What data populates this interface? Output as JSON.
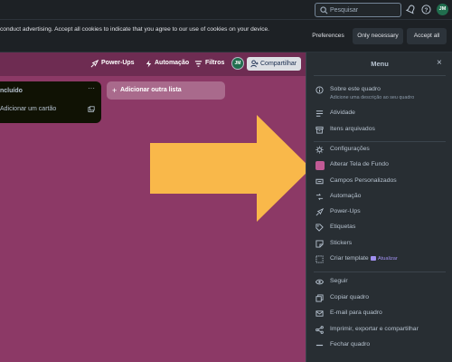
{
  "topbar": {
    "search_placeholder": "Pesquisar",
    "avatar_initials": "JM"
  },
  "cookie_banner": {
    "message": "conduct advertising. Accept all cookies to indicate that you agree to our use of cookies on your device.",
    "preferences_label": "Preferences",
    "only_necessary_label": "Only necessary",
    "accept_all_label": "Accept all"
  },
  "board_header": {
    "powerups_label": "Power-Ups",
    "automation_label": "Automação",
    "filters_label": "Filtros",
    "avatar_initials": "JM",
    "share_label": "Compartilhar"
  },
  "list": {
    "title": "ncluído",
    "more": "···",
    "add_card_label": "Adicionar um cartão"
  },
  "add_list_label": "Adicionar outra lista",
  "menu": {
    "title": "Menu",
    "close": "×",
    "groups": [
      [
        {
          "icon": "info-icon",
          "label": "Sobre este quadro",
          "sub": "Adicione uma descrição ao seu quadro"
        },
        {
          "icon": "activity-icon",
          "label": "Atividade"
        },
        {
          "icon": "archive-icon",
          "label": "Itens arquivados"
        }
      ],
      [
        {
          "icon": "gear-icon",
          "label": "Configurações"
        },
        {
          "icon": "background-swatch-icon",
          "label": "Alterar Tela de Fundo"
        },
        {
          "icon": "custom-fields-icon",
          "label": "Campos Personalizados"
        },
        {
          "icon": "automation-icon",
          "label": "Automação"
        },
        {
          "icon": "rocket-icon",
          "label": "Power-Ups"
        },
        {
          "icon": "label-icon",
          "label": "Etiquetas"
        },
        {
          "icon": "sticker-icon",
          "label": "Stickers"
        },
        {
          "icon": "template-icon",
          "label": "Criar template",
          "badge": "Atualizar"
        }
      ],
      [
        {
          "icon": "eye-icon",
          "label": "Seguir"
        },
        {
          "icon": "copy-icon",
          "label": "Copiar quadro"
        },
        {
          "icon": "mail-icon",
          "label": "E-mail para quadro"
        },
        {
          "icon": "share-icon",
          "label": "Imprimir, exportar e compartilhar"
        },
        {
          "icon": "minus-icon",
          "label": "Fechar quadro"
        }
      ]
    ]
  },
  "colors": {
    "board_background": "#8c3966",
    "menu_background": "#282e33",
    "arrow": "#f9b84a",
    "swatch": "#c15a95",
    "avatar": "#216e4e"
  }
}
